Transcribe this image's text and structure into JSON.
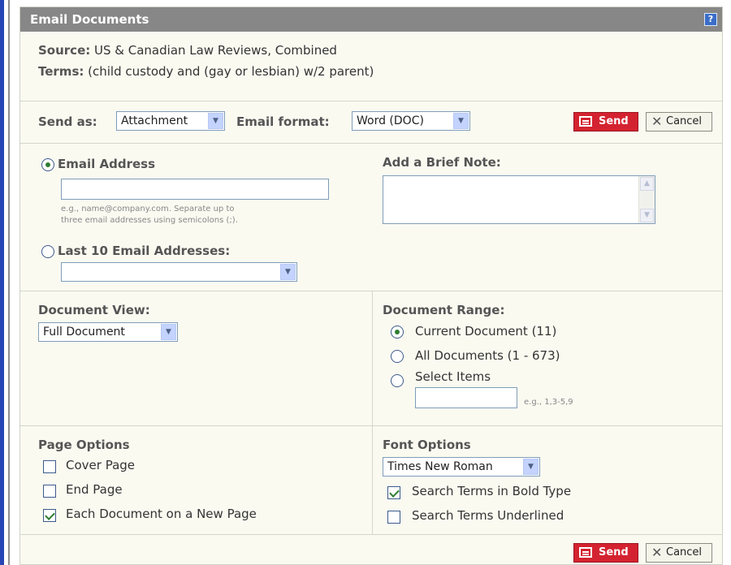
{
  "dialog": {
    "title": "Email Documents",
    "help_icon": "?"
  },
  "source": {
    "source_label": "Source:",
    "source_value": "US & Canadian Law Reviews, Combined",
    "terms_label": "Terms:",
    "terms_value": "(child custody and (gay or lesbian) w/2 parent)"
  },
  "send_options": {
    "send_as_label": "Send as:",
    "send_as_value": "Attachment",
    "email_format_label": "Email format:",
    "email_format_value": "Word (DOC)",
    "send_label": "Send",
    "cancel_label": "Cancel"
  },
  "email": {
    "email_address_label": "Email Address",
    "email_address_value": "",
    "email_hint_line1": "e.g., name@company.com. Separate up to",
    "email_hint_line2": "three email addresses using semicolons (;).",
    "last10_label": "Last 10 Email Addresses:",
    "last10_value": "",
    "note_label": "Add a Brief Note:",
    "note_value": ""
  },
  "document_view": {
    "label": "Document View:",
    "value": "Full Document"
  },
  "document_range": {
    "label": "Document Range:",
    "options": [
      {
        "label": "Current Document (11)",
        "selected": true
      },
      {
        "label": "All Documents (1 - 673)",
        "selected": false
      },
      {
        "label": "Select Items",
        "selected": false
      }
    ],
    "select_items_value": "",
    "select_items_hint": "e.g., 1,3-5,9"
  },
  "page_options": {
    "label": "Page Options",
    "items": [
      {
        "label": "Cover Page",
        "checked": false
      },
      {
        "label": "End Page",
        "checked": false
      },
      {
        "label": "Each Document on a New Page",
        "checked": true
      }
    ]
  },
  "font_options": {
    "label": "Font Options",
    "font_value": "Times New Roman",
    "items": [
      {
        "label": "Search Terms in Bold Type",
        "checked": true
      },
      {
        "label": "Search Terms Underlined",
        "checked": false
      }
    ]
  },
  "bottom": {
    "send_label": "Send",
    "cancel_label": "Cancel"
  },
  "colors": {
    "title_bar": "#878787",
    "send_button": "#d42330",
    "panel_bg": "#fafaf1",
    "select_arrow": "#c3d3fd"
  }
}
